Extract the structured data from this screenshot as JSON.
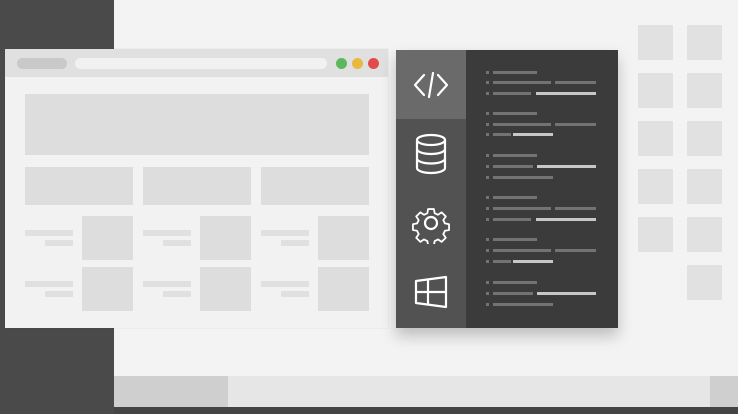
{
  "desktop": {
    "description": "",
    "icon_grid_columns": 2,
    "taskbar": {}
  },
  "browser": {
    "window_controls": [
      {
        "name": "green-control-dot",
        "color": "#5cb85c"
      },
      {
        "name": "yellow-control-dot",
        "color": "#e7b93f"
      },
      {
        "name": "red-control-dot",
        "color": "#e24b4b"
      }
    ]
  },
  "code_panel": {
    "tabs": [
      {
        "name": "tab-code",
        "icon": "code-icon",
        "active": true
      },
      {
        "name": "tab-database",
        "icon": "database-icon",
        "active": false
      },
      {
        "name": "tab-settings",
        "icon": "gear-icon",
        "active": false
      },
      {
        "name": "tab-windows",
        "icon": "windows-icon",
        "active": false
      }
    ]
  }
}
